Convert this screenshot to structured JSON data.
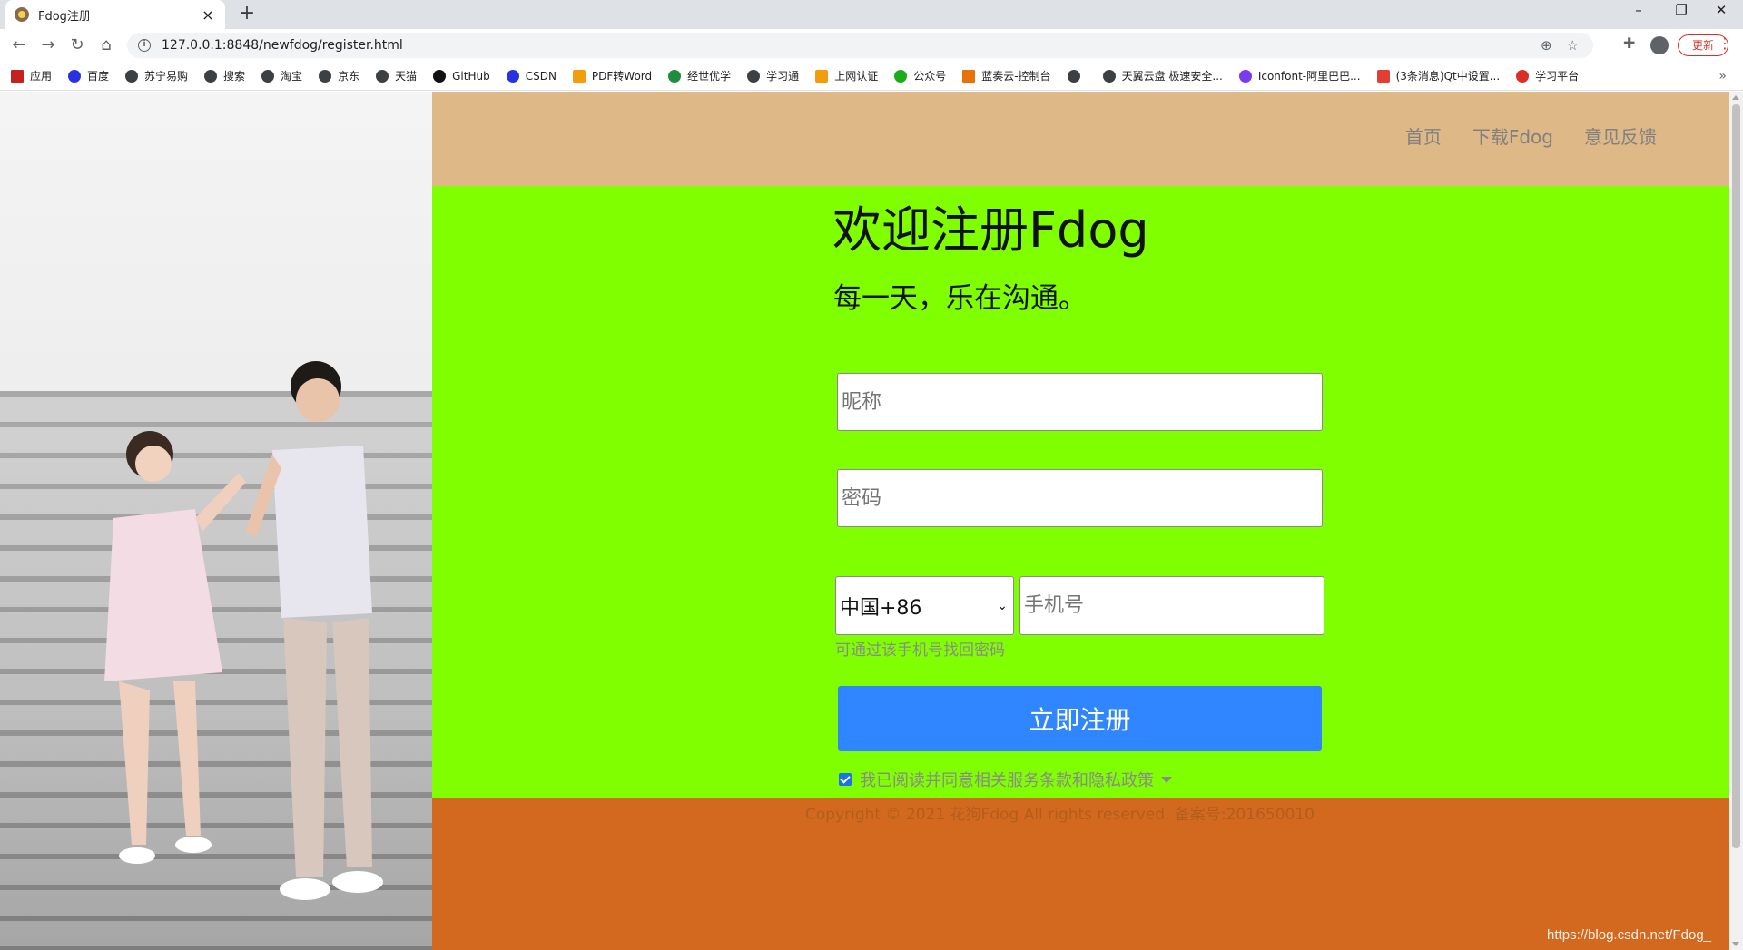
{
  "browser": {
    "tab_title": "Fdog注册",
    "tab_close": "×",
    "new_tab": "+",
    "url": "127.0.0.1:8848/newfdog/register.html",
    "update_label": "更新",
    "window_controls": [
      "–",
      "❐",
      "✕"
    ],
    "bookmarks": [
      "应用",
      "百度",
      "苏宁易购",
      "搜索",
      "淘宝",
      "京东",
      "天猫",
      "GitHub",
      "CSDN",
      "PDF转Word",
      "经世优学",
      "学习通",
      "上网认证",
      "公众号",
      "蓝奏云-控制台",
      "",
      "天翼云盘 极速安全...",
      "Iconfont-阿里巴巴...",
      "(3条消息)Qt中设置...",
      "学习平台"
    ],
    "bookmarks_more": "»"
  },
  "nav": {
    "home": "首页",
    "download": "下载Fdog",
    "feedback": "意见反馈"
  },
  "hero": {
    "title": "欢迎注册Fdog",
    "subtitle": "每一天，乐在沟通。"
  },
  "form": {
    "nickname_placeholder": "昵称",
    "password_placeholder": "密码",
    "country_code": "中国+86",
    "phone_placeholder": "手机号",
    "phone_hint": "可通过该手机号找回密码",
    "submit_label": "立即注册",
    "agree_text": "我已阅读并同意相关服务条款和隐私政策"
  },
  "footer": {
    "copyright": "Copyright © 2021  花狗Fdog  All rights reserved. 备案号:201650010"
  },
  "watermark": "https://blog.csdn.net/Fdog_",
  "colors": {
    "header": "#deb887",
    "main": "#7fff00",
    "footer": "#d2691e",
    "button": "#2f86ff"
  }
}
